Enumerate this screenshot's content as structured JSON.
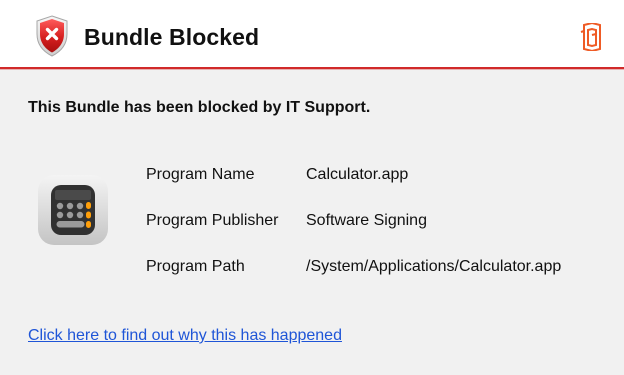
{
  "header": {
    "title": "Bundle Blocked",
    "status_icon": "shield-x-icon",
    "brand_icon": "brand-logo-icon"
  },
  "content": {
    "message": "This Bundle has been blocked by IT Support.",
    "app_icon": "calculator-icon",
    "details": [
      {
        "label": "Program Name",
        "value": "Calculator.app"
      },
      {
        "label": "Program Publisher",
        "value": "Software Signing"
      },
      {
        "label": "Program Path",
        "value": "/System/Applications/Calculator.app"
      }
    ],
    "link_text": "Click here to find out why this has happened"
  },
  "colors": {
    "accent": "#d12a2a",
    "link": "#1f55d7",
    "brand_orange": "#ef5b25"
  }
}
